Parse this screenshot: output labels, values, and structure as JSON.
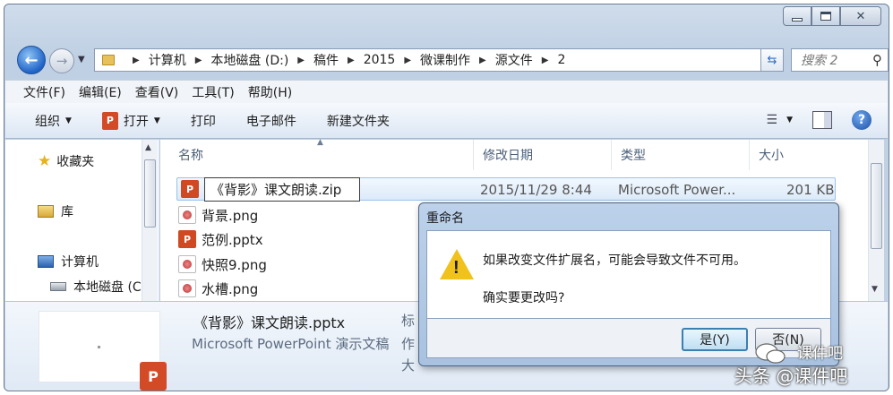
{
  "address": {
    "crumbs": [
      "计算机",
      "本地磁盘 (D:)",
      "稿件",
      "2015",
      "微课制作",
      "源文件",
      "2"
    ],
    "search_placeholder": "搜索 2"
  },
  "menu": [
    "文件(F)",
    "编辑(E)",
    "查看(V)",
    "工具(T)",
    "帮助(H)"
  ],
  "toolbar": {
    "organize": "组织",
    "open": "打开",
    "print": "打印",
    "email": "电子邮件",
    "new_folder": "新建文件夹",
    "ppt_badge": "P"
  },
  "nav_pane": {
    "favorites": "收藏夹",
    "libraries": "库",
    "computer": "计算机",
    "local_disk": "本地磁盘 (C"
  },
  "columns": {
    "name": "名称",
    "modified": "修改日期",
    "type": "类型",
    "size": "大小"
  },
  "files": [
    {
      "name": "《背影》课文朗读.zip",
      "icon": "ppt-icon",
      "modified": "2015/11/29 8:44",
      "type": "Microsoft Power...",
      "size": "201 KB",
      "renaming": true
    },
    {
      "name": "背景.png",
      "icon": "png-icon"
    },
    {
      "name": "范例.pptx",
      "icon": "ppt-icon"
    },
    {
      "name": "快照9.png",
      "icon": "png-icon"
    },
    {
      "name": "水槽.png",
      "icon": "png-icon"
    }
  ],
  "details": {
    "name": "《背影》课文朗读.pptx",
    "type": "Microsoft PowerPoint 演示文稿",
    "labels": [
      "标",
      "作",
      "大"
    ],
    "badge": "P"
  },
  "dialog": {
    "title": "重命名",
    "message": "如果改变文件扩展名，可能会导致文件不可用。",
    "question": "确实要更改吗?",
    "yes": "是(Y)",
    "no": "否(N)"
  },
  "watermark": {
    "top": "课件吧",
    "bottom": "头条 @课件吧"
  },
  "colors": {
    "accent": "#1f63c7",
    "ppt": "#d34b26",
    "warning": "#f1c21b"
  }
}
